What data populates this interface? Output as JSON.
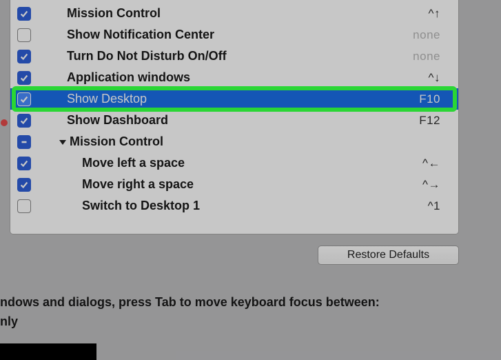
{
  "rows": [
    {
      "label": "Mission Control",
      "shortcut": "^↑",
      "checked": "on",
      "indent": 1,
      "sc_class": ""
    },
    {
      "label": "Show Notification Center",
      "shortcut": "none",
      "checked": "off",
      "indent": 1,
      "sc_class": "none"
    },
    {
      "label": "Turn Do Not Disturb On/Off",
      "shortcut": "none",
      "checked": "on",
      "indent": 1,
      "sc_class": "none"
    },
    {
      "label": "Application windows",
      "shortcut": "^↓",
      "checked": "on",
      "indent": 1,
      "sc_class": ""
    },
    {
      "label": "Show Desktop",
      "shortcut": "F10",
      "checked": "on",
      "indent": 1,
      "sc_class": "",
      "highlight": true
    },
    {
      "label": "Show Dashboard",
      "shortcut": "F12",
      "checked": "on",
      "indent": 1,
      "sc_class": ""
    },
    {
      "label": "Mission Control",
      "shortcut": "",
      "checked": "mixed",
      "indent": 1,
      "expander": true
    },
    {
      "label": "Move left a space",
      "shortcut": "^←",
      "checked": "on",
      "indent": 2,
      "sc_class": ""
    },
    {
      "label": "Move right a space",
      "shortcut": "^→",
      "checked": "on",
      "indent": 2,
      "sc_class": ""
    },
    {
      "label": "Switch to Desktop 1",
      "shortcut": "^1",
      "checked": "off",
      "indent": 2,
      "sc_class": ""
    }
  ],
  "restore_label": "Restore Defaults",
  "footer_line1": "ndows and dialogs, press Tab to move keyboard focus between:",
  "footer_line2": "nly"
}
